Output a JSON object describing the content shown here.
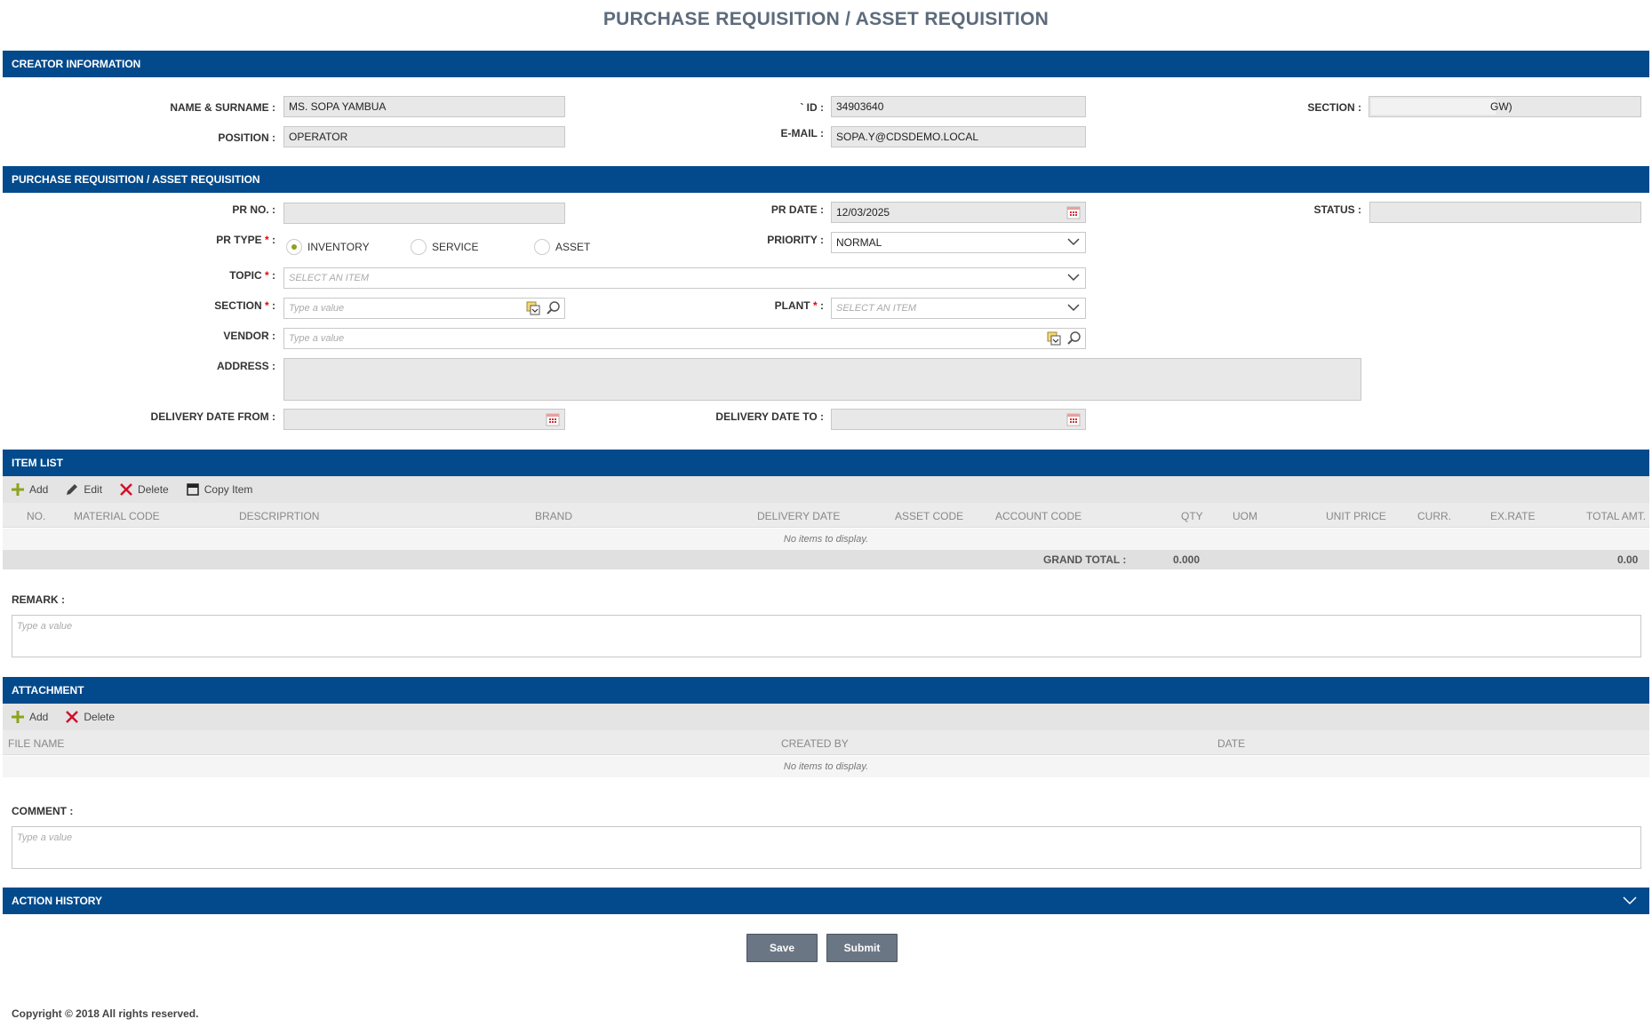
{
  "page": {
    "title": "PURCHASE  REQUISITION / ASSET REQUISITION"
  },
  "creator": {
    "header": "CREATOR INFORMATION",
    "name_label": "NAME & SURNAME :",
    "name_value": "MS. SOPA YAMBUA",
    "position_label": "POSITION :",
    "position_value": "OPERATOR",
    "id_label": "` ID :",
    "id_value": "34903640",
    "email_label": "E-MAIL :",
    "email_value": "SOPA.Y@CDSDEMO.LOCAL",
    "section_label": "SECTION :",
    "section_value": "GW)"
  },
  "pr": {
    "header": "PURCHASE REQUISITION / ASSET REQUISITION",
    "prno_label": "PR NO. :",
    "prno_value": "",
    "prdate_label": "PR DATE :",
    "prdate_value": "12/03/2025",
    "status_label": "STATUS :",
    "status_value": "",
    "prtype_label": "PR TYPE",
    "prtype_suffix": " :",
    "prtype_options": [
      "INVENTORY",
      "SERVICE",
      "ASSET"
    ],
    "prtype_selected": "INVENTORY",
    "priority_label": "PRIORITY :",
    "priority_value": "NORMAL",
    "topic_label": "TOPIC",
    "topic_placeholder": "SELECT AN ITEM",
    "section_label": "SECTION",
    "section_placeholder": "Type a value",
    "plant_label": "PLANT",
    "plant_placeholder": "SELECT AN ITEM",
    "vendor_label": "VENDOR :",
    "vendor_placeholder": "Type a value",
    "address_label": "ADDRESS :",
    "ddfrom_label": "DELIVERY DATE FROM :",
    "ddto_label": "DELIVERY DATE TO :",
    "required_mark": "*",
    "colon": " :"
  },
  "items": {
    "header": "ITEM LIST",
    "toolbar": {
      "add": "Add",
      "edit": "Edit",
      "delete": "Delete",
      "copy": "Copy Item"
    },
    "columns": [
      "NO.",
      "MATERIAL CODE",
      "DESCRIPRTION",
      "BRAND",
      "DELIVERY DATE",
      "ASSET CODE",
      "ACCOUNT CODE",
      "QTY",
      "UOM",
      "UNIT PRICE",
      "CURR.",
      "EX.RATE",
      "TOTAL AMT."
    ],
    "empty_text": "No items to display.",
    "grand_total_label": "GRAND TOTAL :",
    "grand_total_qty": "0.000",
    "grand_total_amt": "0.00"
  },
  "remark": {
    "label": "REMARK :",
    "placeholder": "Type a value"
  },
  "attachment": {
    "header": "ATTACHMENT",
    "toolbar": {
      "add": "Add",
      "delete": "Delete"
    },
    "columns": [
      "FILE NAME",
      "CREATED BY",
      "DATE"
    ],
    "empty_text": "No items to display."
  },
  "comment": {
    "label": "COMMENT :",
    "placeholder": "Type a value"
  },
  "history": {
    "header": "ACTION HISTORY"
  },
  "buttons": {
    "save": "Save",
    "submit": "Submit"
  },
  "footer": {
    "copyright": "Copyright © 2018 All rights reserved."
  },
  "icons": {
    "calendar": "calendar-icon",
    "lookup": "lookup-list-icon",
    "search": "search-icon",
    "add": "plus-icon",
    "edit": "pencil-icon",
    "delete": "x-icon",
    "copy": "copy-icon",
    "dropdown": "chevron-down-icon"
  },
  "colors": {
    "header_bar": "#034a8c",
    "button": "#6b7685",
    "add_icon": "#8ba31c",
    "delete_icon": "#d0102a",
    "required": "#e00000"
  }
}
